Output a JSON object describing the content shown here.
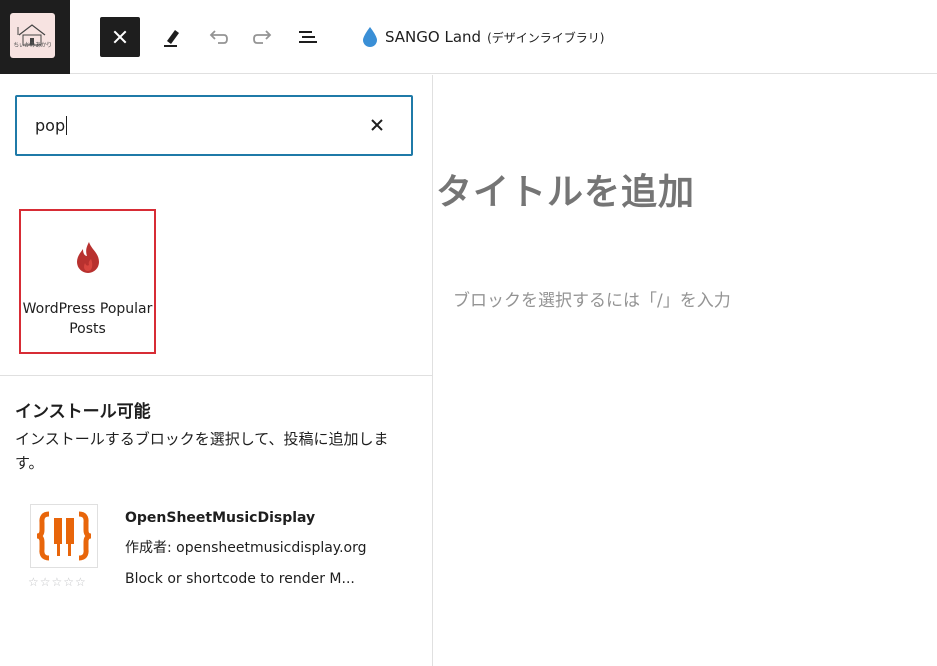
{
  "toolbar": {
    "site_logo_text": "ちぃかみあかり",
    "doc_title": "SANGO Land",
    "doc_subtitle": "(デザインライブラリ)",
    "icons": [
      "close-icon",
      "pen-icon",
      "undo-icon",
      "redo-icon",
      "list-view-icon",
      "drop-icon"
    ]
  },
  "search": {
    "value": "pop",
    "placeholder": "検索"
  },
  "results": [
    {
      "label": "WordPress Popular Posts",
      "icon": "flame-icon"
    }
  ],
  "installable": {
    "heading": "インストール可能",
    "description": "インストールするブロックを選択して、投稿に追加します。",
    "plugins": [
      {
        "name": "OpenSheetMusicDisplay",
        "author": "作成者: opensheetmusicdisplay.org",
        "description": "Block or shortcode to render M...",
        "rating_stars": 0,
        "rating_max": 5
      }
    ]
  },
  "editor": {
    "title_placeholder": "タイトルを追加",
    "block_placeholder": "ブロックを選択するには「/」を入力"
  },
  "colors": {
    "focus_blue": "#1f7aa8",
    "highlight_red": "#d72c35",
    "flame_red": "#b8312f",
    "osmd_orange": "#e8650a"
  }
}
